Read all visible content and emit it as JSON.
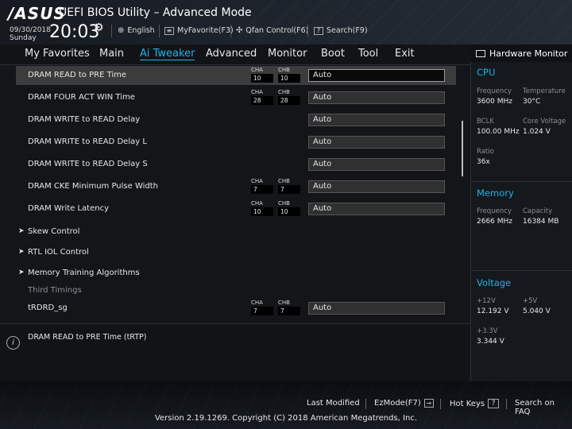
{
  "header": {
    "logo": "/ASUS",
    "title": "UEFI BIOS Utility – Advanced Mode",
    "date": "09/30/2018",
    "day": "Sunday",
    "time": "20:03",
    "language": "English",
    "my_favorite": "MyFavorite(F3)",
    "qfan": "Qfan Control(F6)",
    "search": "Search(F9)"
  },
  "menu": {
    "tabs": [
      "My Favorites",
      "Main",
      "Ai Tweaker",
      "Advanced",
      "Monitor",
      "Boot",
      "Tool",
      "Exit"
    ],
    "active": "Ai Tweaker"
  },
  "settings": {
    "cha_label": "CHA",
    "chb_label": "CHB",
    "rows": [
      {
        "label": "DRAM READ to PRE Time",
        "cha": "10",
        "chb": "10",
        "value": "Auto"
      },
      {
        "label": "DRAM FOUR ACT WIN Time",
        "cha": "28",
        "chb": "28",
        "value": "Auto"
      },
      {
        "label": "DRAM WRITE to READ Delay",
        "value": "Auto"
      },
      {
        "label": "DRAM WRITE to READ Delay L",
        "value": "Auto"
      },
      {
        "label": "DRAM WRITE to READ Delay S",
        "value": "Auto"
      },
      {
        "label": "DRAM CKE Minimum Pulse Width",
        "cha": "7",
        "chb": "7",
        "value": "Auto"
      },
      {
        "label": "DRAM Write Latency",
        "cha": "10",
        "chb": "10",
        "value": "Auto"
      },
      {
        "label": "Skew Control"
      },
      {
        "label": "RTL IOL Control"
      },
      {
        "label": "Memory Training Algorithms"
      },
      {
        "label": "Third Timings"
      },
      {
        "label": "tRDRD_sg",
        "cha": "7",
        "chb": "7",
        "value": "Auto"
      }
    ]
  },
  "info": {
    "text": "DRAM READ to PRE Time (tRTP)"
  },
  "hardware_monitor": {
    "title": "Hardware Monitor",
    "cpu": {
      "title": "CPU",
      "frequency_label": "Frequency",
      "frequency": "3600 MHz",
      "temperature_label": "Temperature",
      "temperature": "30°C",
      "bclk_label": "BCLK",
      "bclk": "100.00 MHz",
      "core_voltage_label": "Core Voltage",
      "core_voltage": "1.024 V",
      "ratio_label": "Ratio",
      "ratio": "36x"
    },
    "memory": {
      "title": "Memory",
      "frequency_label": "Frequency",
      "frequency": "2666 MHz",
      "capacity_label": "Capacity",
      "capacity": "16384 MB"
    },
    "voltage": {
      "title": "Voltage",
      "v12_label": "+12V",
      "v12": "12.192 V",
      "v5_label": "+5V",
      "v5": "5.040 V",
      "v33_label": "+3.3V",
      "v33": "3.344 V"
    }
  },
  "footer": {
    "last_modified": "Last Modified",
    "ezmode": "EzMode(F7)",
    "hotkeys": "Hot Keys",
    "hotkeys_key": "?",
    "search_faq": "Search on FAQ",
    "version": "Version 2.19.1269. Copyright (C) 2018 American Megatrends, Inc."
  },
  "colors": {
    "accent": "#19b6e8",
    "background": "#0f1114",
    "selected_row": "#3c3c3c"
  }
}
